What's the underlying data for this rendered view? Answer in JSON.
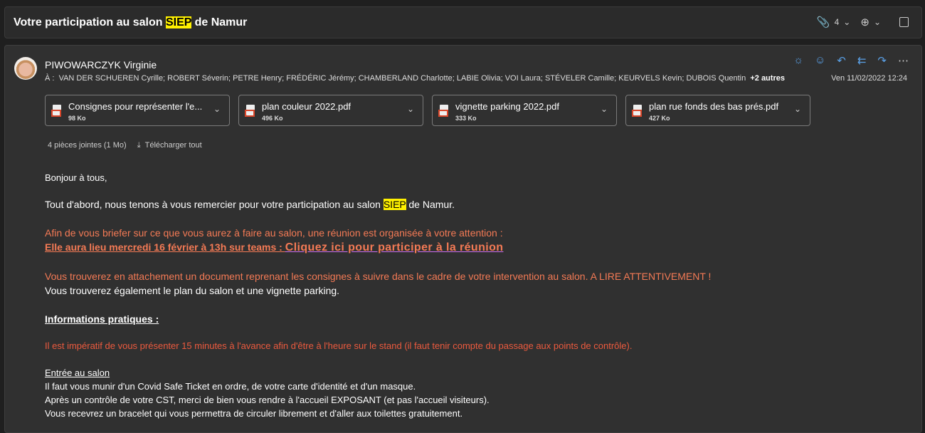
{
  "subject": {
    "before": "Votre participation au salon ",
    "highlight": "SIEP",
    "after": " de Namur"
  },
  "toolbar": {
    "attachment_count": "4",
    "attach_icon": "paperclip-icon",
    "zoom_icon": "zoom-in-icon",
    "popout_icon": "popout-icon"
  },
  "message": {
    "sender": "PIWOWARCZYK Virginie",
    "to_label": "À :",
    "recipients": "VAN DER SCHUEREN Cyrille;  ROBERT Séverin;  PETRE Henry;  FRÉDÉRIC Jérémy;  CHAMBERLAND Charlotte;  LABIE Olivia;  VOI Laura;  STÉVELER Camille;  KEURVELS Kevin;  DUBOIS Quentin",
    "more": "+2 autres",
    "date": "Ven 11/02/2022 12:24",
    "actions": [
      "sun-icon",
      "emoji-icon",
      "reply-icon",
      "reply-all-icon",
      "forward-icon",
      "more-icon"
    ]
  },
  "attachments": [
    {
      "name": "Consignes pour représenter l'e...",
      "size": "98 Ko"
    },
    {
      "name": "plan couleur 2022.pdf",
      "size": "496 Ko"
    },
    {
      "name": "vignette parking 2022.pdf",
      "size": "333 Ko"
    },
    {
      "name": "plan rue fonds des bas prés.pdf",
      "size": "427 Ko"
    }
  ],
  "attachments_summary": "4 pièces jointes (1 Mo)",
  "download_all": "Télécharger tout",
  "body": {
    "greeting": "Bonjour à tous,",
    "p1_before": "Tout d'abord, nous tenons à vous remercier pour votre participation au salon ",
    "p1_highlight": "SIEP",
    "p1_after": " de Namur.",
    "p2": "Afin de vous briefer sur ce que vous aurez à faire au salon, une réunion est organisée à votre attention :",
    "p3": "Elle aura lieu mercredi 16 février à 13h sur teams : ",
    "link": "Cliquez ici pour participer à la réunion",
    "p4": "Vous trouverez en attachement un document reprenant les consignes à suivre dans le cadre de votre intervention au salon. A LIRE ATTENTIVEMENT !",
    "p5": "Vous trouverez également le plan du salon et une vignette parking.",
    "info_heading": "Informations pratiques :",
    "p6": "Il est impératif de vous présenter 15 minutes à l'avance afin d'être à l'heure sur le stand (il faut tenir compte du passage aux points de contrôle).",
    "entry_heading": "Entrée au salon",
    "e1": "Il faut vous munir d'un Covid Safe Ticket en ordre, de votre carte d'identité et d'un masque.",
    "e2": "Après un contrôle de votre CST, merci de bien vous rendre à l'accueil EXPOSANT (et pas l'accueil visiteurs).",
    "e3": "Vous recevrez un bracelet qui vous permettra de circuler librement et d'aller aux toilettes gratuitement."
  }
}
